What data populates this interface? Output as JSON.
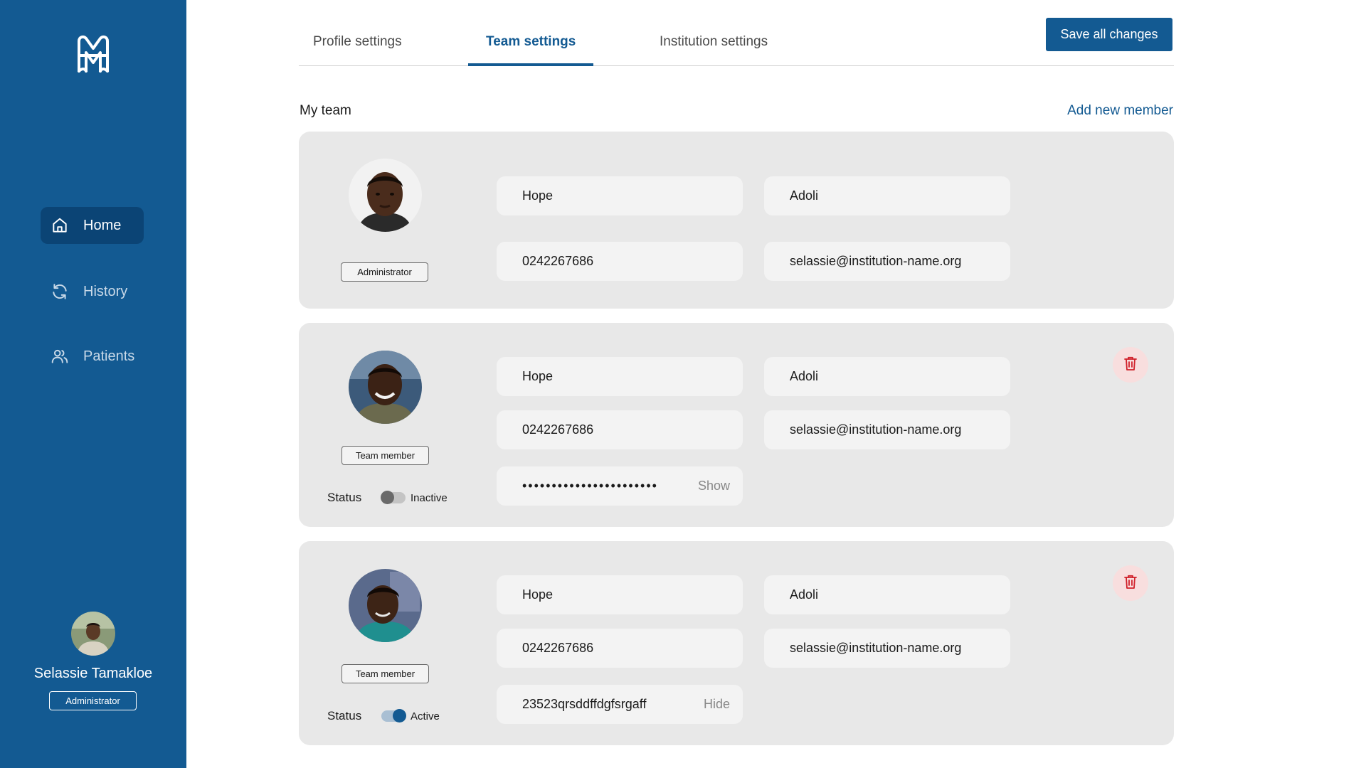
{
  "sidebar": {
    "logo_icon": "m-monogram-logo",
    "nav": [
      {
        "label": "Home",
        "icon": "home-icon",
        "active": true
      },
      {
        "label": "History",
        "icon": "refresh-icon",
        "active": false
      },
      {
        "label": "Patients",
        "icon": "users-icon",
        "active": false
      }
    ],
    "user": {
      "name": "Selassie Tamakloe",
      "role": "Administrator"
    }
  },
  "tabs": [
    {
      "label": "Profile settings",
      "active": false
    },
    {
      "label": "Team settings",
      "active": true
    },
    {
      "label": "Institution settings",
      "active": false
    }
  ],
  "save_label": "Save all changes",
  "section": {
    "title": "My team",
    "add_label": "Add new member"
  },
  "members": [
    {
      "role": "Administrator",
      "first_name": "Hope",
      "last_name": "Adoli",
      "phone": "0242267686",
      "email": "selassie@institution-name.org"
    },
    {
      "role": "Team member",
      "first_name": "Hope",
      "last_name": "Adoli",
      "phone": "0242267686",
      "email": "selassie@institution-name.org",
      "password_masked": "•••••••••••••••••••••••",
      "password_toggle": "Show",
      "status_label": "Status",
      "status": "Inactive",
      "active": false
    },
    {
      "role": "Team member",
      "first_name": "Hope",
      "last_name": "Adoli",
      "phone": "0242267686",
      "email": "selassie@institution-name.org",
      "password": "23523qrsddffdgfsrgaff",
      "password_toggle": "Hide",
      "status_label": "Status",
      "status": "Active",
      "active": true
    }
  ],
  "colors": {
    "primary": "#135a92",
    "sidebar_active": "#0b4475",
    "card_bg": "#e8e8e8",
    "field_bg": "#f3f3f3",
    "delete_bg": "#f8dede",
    "delete_icon": "#d0202a"
  }
}
